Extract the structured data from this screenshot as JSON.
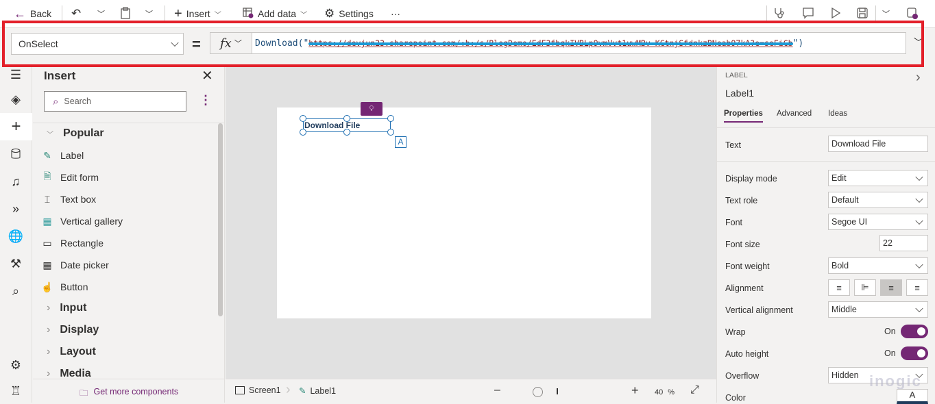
{
  "toolbar": {
    "back": "Back",
    "insert": "Insert",
    "add_data": "Add data",
    "settings": "Settings",
    "more": "···"
  },
  "formula_bar": {
    "property": "OnSelect",
    "equals": "=",
    "fx": "fx",
    "func_open": "Download(\"",
    "url": "https://devjun23.sharepoint.com/:b:/s/BlogDemo/EdF3fbqkIVBLp9vmVvt1uwMBv-KCtnjSfdnkzBNeab97kA?e=seFiCb",
    "func_close": "\")"
  },
  "insert_panel": {
    "title": "Insert",
    "search_placeholder": "Search",
    "popular": "Popular",
    "items": [
      {
        "label": "Label",
        "icon": "label-icon"
      },
      {
        "label": "Edit form",
        "icon": "edit-form-icon"
      },
      {
        "label": "Text box",
        "icon": "text-box-icon"
      },
      {
        "label": "Vertical gallery",
        "icon": "gallery-icon"
      },
      {
        "label": "Rectangle",
        "icon": "rectangle-icon"
      },
      {
        "label": "Date picker",
        "icon": "calendar-icon"
      },
      {
        "label": "Button",
        "icon": "button-icon"
      }
    ],
    "categories": [
      "Input",
      "Display",
      "Layout",
      "Media"
    ],
    "get_more": "Get more components"
  },
  "canvas": {
    "label_text": "Download File",
    "badge": "A"
  },
  "status_bar": {
    "screen": "Screen1",
    "control": "Label1",
    "zoom": "40",
    "zoom_unit": "%"
  },
  "properties_panel": {
    "type": "LABEL",
    "name": "Label1",
    "tabs": [
      "Properties",
      "Advanced",
      "Ideas"
    ],
    "active_tab": "Properties",
    "text_label": "Text",
    "text_value": "Download File",
    "rows": {
      "display_mode": {
        "label": "Display mode",
        "value": "Edit"
      },
      "text_role": {
        "label": "Text role",
        "value": "Default"
      },
      "font": {
        "label": "Font",
        "value": "Segoe UI"
      },
      "font_size": {
        "label": "Font size",
        "value": "22"
      },
      "font_weight": {
        "label": "Font weight",
        "value": "Bold"
      },
      "alignment": {
        "label": "Alignment",
        "value": "Left"
      },
      "vertical_alignment": {
        "label": "Vertical alignment",
        "value": "Middle"
      },
      "wrap": {
        "label": "Wrap",
        "value": "On"
      },
      "auto_height": {
        "label": "Auto height",
        "value": "On"
      },
      "overflow": {
        "label": "Overflow",
        "value": "Hidden"
      },
      "color": {
        "label": "Color",
        "value": "A"
      }
    }
  },
  "watermark": "inogic",
  "colors": {
    "accent": "#742774",
    "highlight_box": "#e3202a",
    "selection": "#1f6fb2"
  }
}
